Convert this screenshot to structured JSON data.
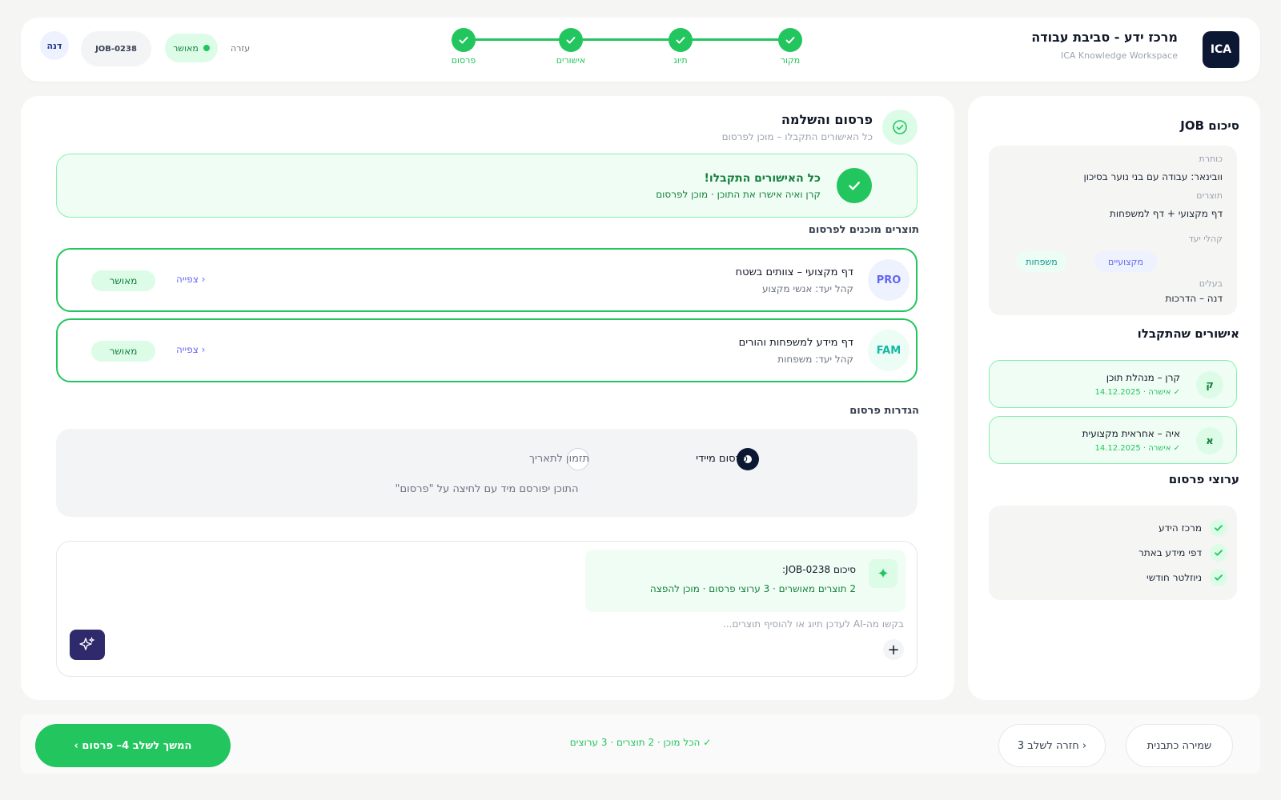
{
  "header": {
    "logo": "ICA",
    "title": "מרכז ידע - סביבת עבודה",
    "subtitle": "ICA Knowledge Workspace",
    "steps": [
      {
        "label": "מקור"
      },
      {
        "label": "תיוג"
      },
      {
        "label": "אישורים"
      },
      {
        "label": "פרסום"
      }
    ],
    "help": "עזרה",
    "status": "מאושר",
    "job": "JOB-0238",
    "user": "דנה",
    "colors": {
      "accent": "#22c55e",
      "brand": "#0b1733"
    }
  },
  "main": {
    "title": "פרסום והשלמה",
    "subtitle": "כל האישורים התקבלו – מוכן לפרסום",
    "banner": {
      "title": "כל האישורים התקבלו!",
      "text": "קרן ואיה אישרו את התוכן · מוכן לפרסום"
    },
    "products_heading": "תוצרים מוכנים לפרסום",
    "products": [
      {
        "badge": "PRO",
        "title": "דף מקצועי – צוותים בשטח",
        "audience": "קהל יעד: אנשי מקצוע",
        "view": "צפייה ›",
        "status": "מאושר"
      },
      {
        "badge": "FAM",
        "title": "דף מידע למשפחות והורים",
        "audience": "קהל יעד: משפחות",
        "view": "צפייה ›",
        "status": "מאושר"
      }
    ],
    "settings_heading": "הגדרות פרסום",
    "settings": {
      "option_now": "פרסום מיידי",
      "option_schedule": "תזמון לתאריך",
      "note": "התוכן יפורסם מיד עם לחיצה על \"פרסום\""
    },
    "composer": {
      "ai_title": "סיכום JOB-0238:",
      "ai_text": "2 תוצרים מאושרים · 3 ערוצי פרסום · מוכן להפצה",
      "placeholder": "בקשו מה-AI לעדכן תיוג או להוסיף תוצרים..."
    }
  },
  "sidebar": {
    "summary_title": "סיכום JOB",
    "fields": {
      "title_key": "כותרת",
      "title_val": "וובינאר: עבודה עם בני נוער בסיכון",
      "products_key": "תוצרים",
      "products_val": "דף מקצועי + דף למשפחות",
      "audience_key": "קהלי יעד",
      "audience_tags": [
        "מקצועיים",
        "משפחות"
      ],
      "owner_key": "בעלים",
      "owner_val": "דנה – הדרכות"
    },
    "approvals_title": "אישורים שהתקבלו",
    "approvals": [
      {
        "initial": "ק",
        "name": "קרן – מנהלת תוכן",
        "meta": "✓ אישרה · 14.12.2025"
      },
      {
        "initial": "א",
        "name": "איה – אחראית מקצועית",
        "meta": "✓ אישרה · 14.12.2025"
      }
    ],
    "channels_title": "ערוצי פרסום",
    "channels": [
      "מרכז הידע",
      "דפי מידע באתר",
      "ניוזלטר חודשי"
    ]
  },
  "footer": {
    "next": "המשך לשלב 4– פרסום ›",
    "status": "✓ הכל מוכן · 2 תוצרים · 3 ערוצים",
    "back": "‹ חזרה לשלב 3",
    "save": "שמירה כתבנית"
  }
}
